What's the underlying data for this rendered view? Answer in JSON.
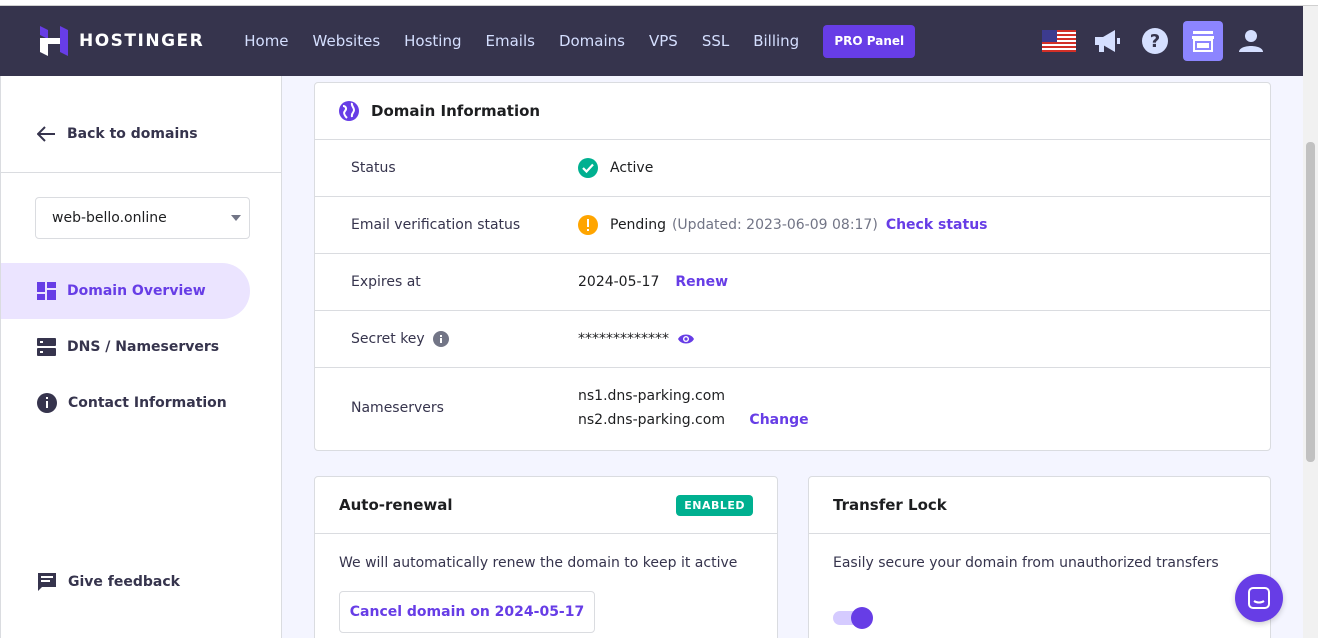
{
  "header": {
    "brand": "HOSTINGER",
    "nav": [
      "Home",
      "Websites",
      "Hosting",
      "Emails",
      "Domains",
      "VPS",
      "SSL",
      "Billing"
    ],
    "pro_button": "PRO Panel",
    "icons": [
      "us-flag-icon",
      "megaphone-icon",
      "help-icon",
      "store-icon",
      "account-icon"
    ]
  },
  "sidebar": {
    "back": "Back to domains",
    "domain_selected": "web-bello.online",
    "items": [
      {
        "label": "Domain Overview",
        "icon": "dashboard-icon",
        "active": true
      },
      {
        "label": "DNS / Nameservers",
        "icon": "server-icon",
        "active": false
      },
      {
        "label": "Contact Information",
        "icon": "info-icon",
        "active": false
      }
    ],
    "feedback": "Give feedback"
  },
  "domain_info": {
    "title": "Domain Information",
    "status": {
      "label": "Status",
      "value": "Active"
    },
    "email_verification": {
      "label": "Email verification status",
      "value": "Pending",
      "updated": "(Updated: 2023-06-09 08:17)",
      "action": "Check status"
    },
    "expires": {
      "label": "Expires at",
      "value": "2024-05-17",
      "action": "Renew"
    },
    "secret_key": {
      "label": "Secret key",
      "value": "*************"
    },
    "nameservers": {
      "label": "Nameservers",
      "values": [
        "ns1.dns-parking.com",
        "ns2.dns-parking.com"
      ],
      "action": "Change"
    }
  },
  "auto_renewal": {
    "title": "Auto-renewal",
    "badge": "ENABLED",
    "text": "We will automatically renew the domain to keep it active",
    "button": "Cancel domain on 2024-05-17"
  },
  "transfer_lock": {
    "title": "Transfer Lock",
    "text": "Easily secure your domain from unauthorized transfers",
    "enabled": true
  },
  "colors": {
    "accent": "#673de6",
    "header_bg": "#36344d",
    "success": "#00b090",
    "warning": "#ffa500"
  }
}
